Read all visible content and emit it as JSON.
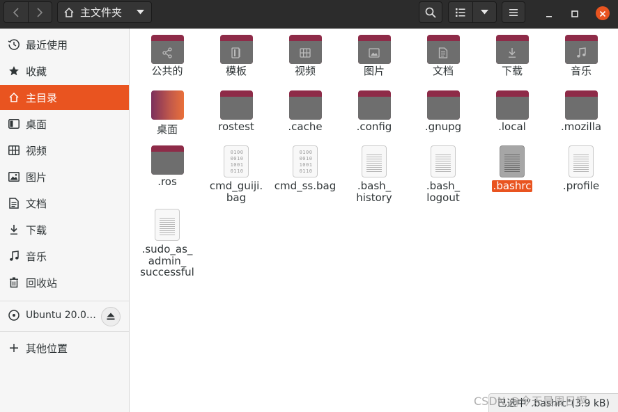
{
  "header": {
    "location_label": "主文件夹",
    "icons": {
      "back": "chevron-left-icon",
      "forward": "chevron-right-icon",
      "home": "home-icon",
      "location_menu": "triangle-down-icon",
      "search": "search-icon",
      "view_list": "list-view-icon",
      "view_options": "triangle-down-icon",
      "menu": "hamburger-icon",
      "minimize": "minimize-icon",
      "maximize": "maximize-icon",
      "close": "close-icon"
    }
  },
  "sidebar": {
    "items": [
      {
        "label": "最近使用",
        "icon": "clock-icon"
      },
      {
        "label": "收藏",
        "icon": "star-icon"
      },
      {
        "label": "主目录",
        "icon": "home-icon",
        "active": true
      },
      {
        "label": "桌面",
        "icon": "desktop-icon"
      },
      {
        "label": "视频",
        "icon": "film-icon"
      },
      {
        "label": "图片",
        "icon": "image-icon"
      },
      {
        "label": "文档",
        "icon": "document-icon"
      },
      {
        "label": "下载",
        "icon": "download-icon"
      },
      {
        "label": "音乐",
        "icon": "music-icon"
      },
      {
        "label": "回收站",
        "icon": "trash-icon"
      }
    ],
    "device": {
      "label": "Ubuntu 20.0…",
      "icon": "disc-icon",
      "eject_icon": "eject-icon"
    },
    "other": {
      "label": "其他位置",
      "icon": "plus-icon"
    }
  },
  "files": [
    {
      "name": "公共的",
      "kind": "folder",
      "icon": "share-icon"
    },
    {
      "name": "模板",
      "kind": "folder",
      "icon": "template-icon"
    },
    {
      "name": "视频",
      "kind": "folder",
      "icon": "film-icon"
    },
    {
      "name": "图片",
      "kind": "folder",
      "icon": "image-icon"
    },
    {
      "name": "文档",
      "kind": "folder",
      "icon": "document-icon"
    },
    {
      "name": "下载",
      "kind": "folder",
      "icon": "download-icon"
    },
    {
      "name": "音乐",
      "kind": "folder",
      "icon": "music-icon"
    },
    {
      "name": "桌面",
      "kind": "desktop-folder",
      "icon": "desktop-icon"
    },
    {
      "name": "rostest",
      "kind": "folder",
      "icon": "folder-icon"
    },
    {
      "name": ".cache",
      "kind": "folder",
      "icon": "folder-icon"
    },
    {
      "name": ".config",
      "kind": "folder",
      "icon": "folder-icon"
    },
    {
      "name": ".gnupg",
      "kind": "folder",
      "icon": "folder-icon"
    },
    {
      "name": ".local",
      "kind": "folder",
      "icon": "folder-icon"
    },
    {
      "name": ".mozilla",
      "kind": "folder",
      "icon": "folder-icon"
    },
    {
      "name": ".ros",
      "kind": "folder",
      "icon": "folder-icon"
    },
    {
      "name": "cmd_guiji.\nbag",
      "kind": "binary",
      "icon": "binary-file-icon"
    },
    {
      "name": "cmd_ss.bag",
      "kind": "binary",
      "icon": "binary-file-icon"
    },
    {
      "name": ".bash_\nhistory",
      "kind": "text",
      "icon": "text-file-icon"
    },
    {
      "name": ".bash_\nlogout",
      "kind": "text",
      "icon": "text-file-icon"
    },
    {
      "name": ".bashrc",
      "kind": "text",
      "icon": "text-file-icon",
      "selected": true
    },
    {
      "name": ".profile",
      "kind": "text",
      "icon": "text-file-icon"
    },
    {
      "name": ".sudo_as_\nadmin_\nsuccessful",
      "kind": "text",
      "icon": "text-file-icon"
    }
  ],
  "binary_glyph": "0100\n0010\n1001\n0110",
  "status_text": "已选中\".bashrc\"(3.9 kB)",
  "watermark": "CSDN @今天是周日啊",
  "colors": {
    "accent": "#e95420",
    "folder_tab": "#8e2b48",
    "header": "#2c2c2c"
  }
}
